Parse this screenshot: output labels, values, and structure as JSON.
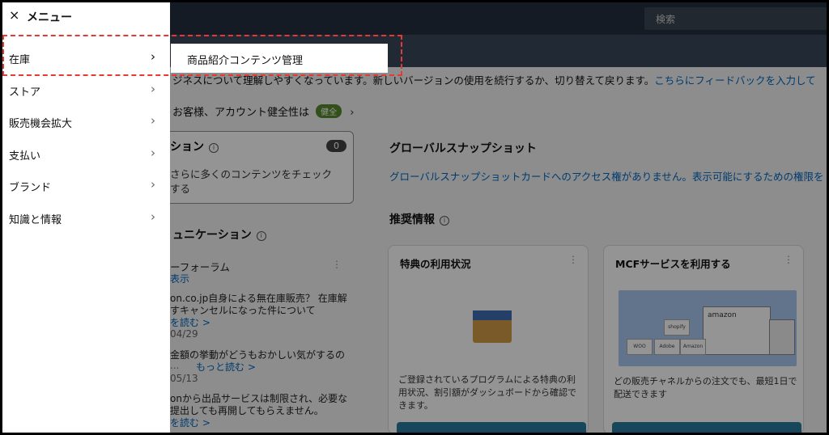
{
  "search": {
    "placeholder": "検索"
  },
  "banner": {
    "text": "ジネスについて理解しやすくなっています。新しいバージョンの使用を続行するか、切り替えて戻ります。",
    "feedback_link": "こちらにフィードバックを入力して"
  },
  "health": {
    "text": "お客様、アカウント健全性は",
    "badge": "健全",
    "chevron": "›"
  },
  "content_card": {
    "title": "ション",
    "count": "0",
    "desc_line1": "さらに多くのコンテンツをチェック",
    "desc_line2": "する"
  },
  "communication": {
    "title": "ュニケーション",
    "forum_title": "ーフォーラム",
    "view": "表示",
    "posts": [
      {
        "line1": "on.co.jp自身による無在庫販売？ 在庫解",
        "line2": "すキャンセルになった件について",
        "more": "を読む >",
        "date": "04/29"
      },
      {
        "line1": "金額の挙動がどうもおかしい気がするの",
        "line2": "...",
        "more": "もっと読む >",
        "date": "05/13"
      },
      {
        "line1": "onから出品サービスは制限され、必要な",
        "line2": "提出しても再開してもらえません。",
        "more": "を読む >",
        "date": ""
      }
    ]
  },
  "global_snapshot": {
    "title": "グローバルスナップショット",
    "text": "グローバルスナップショットカードへのアクセス権がありません。表示可能にするための権限を"
  },
  "recommendations": {
    "title": "推奨情報",
    "cards": [
      {
        "title": "特典の利用状況",
        "desc_line1": "ご登録されているプログラムによる特典の利",
        "desc_line2": "用状況、割引額がダッシュボードから確認で",
        "desc_line3": "きます。"
      },
      {
        "title": "MCFサービスを利用する",
        "desc_line1": "どの販売チャネルからの注文でも、最短1日で",
        "desc_line2": "配送できます",
        "truck_brand": "amazon",
        "tiles": [
          "WOO",
          "shopify",
          "Adobe",
          "Amazon Pay"
        ]
      }
    ]
  },
  "menu": {
    "title": "メニュー",
    "close_icon": "×",
    "items": [
      {
        "label": "在庫",
        "chevron": "›"
      },
      {
        "label": "ストア",
        "chevron": "›"
      },
      {
        "label": "販売機会拡大",
        "chevron": "›"
      },
      {
        "label": "支払い",
        "chevron": "›"
      },
      {
        "label": "ブランド",
        "chevron": "›"
      },
      {
        "label": "知識と情報",
        "chevron": "›"
      }
    ],
    "submenu": {
      "label": "商品紹介コンテンツ管理"
    }
  },
  "colors": {
    "highlight": "#e53935",
    "header": "#232f3e",
    "link": "#0066c0",
    "badge": "#5b8a2d"
  }
}
